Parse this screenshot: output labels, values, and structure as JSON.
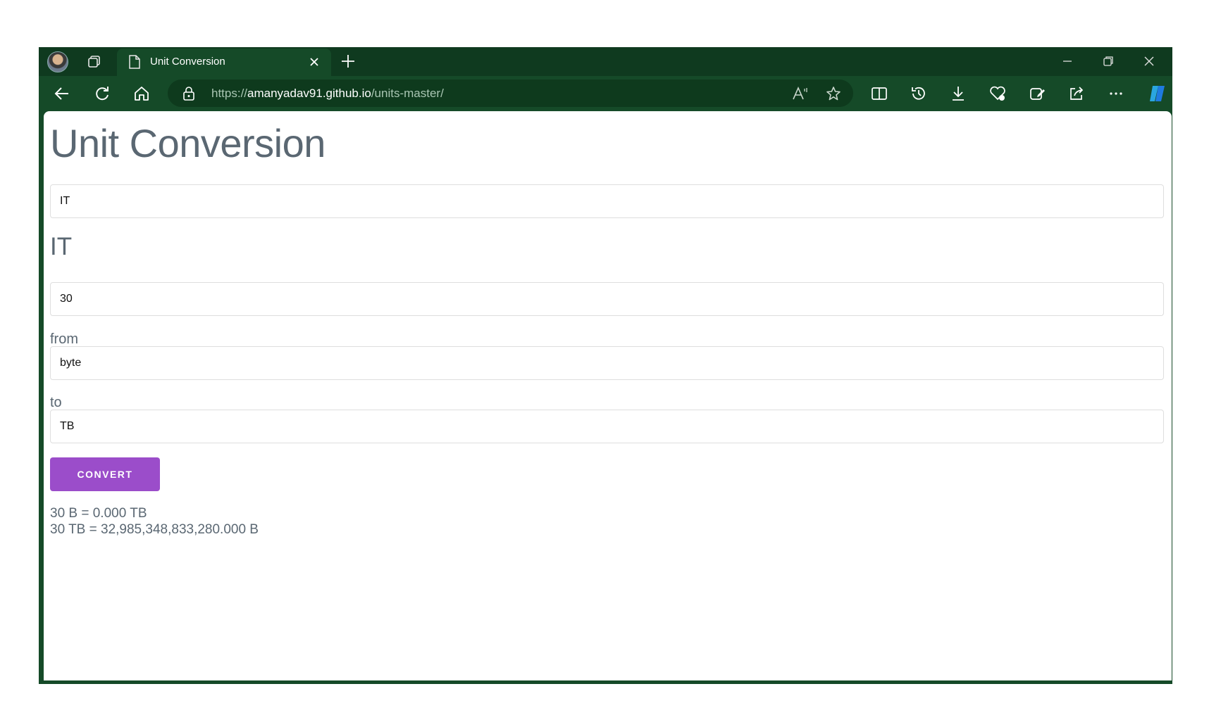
{
  "browser": {
    "tab_title": "Unit Conversion",
    "url_scheme": "https://",
    "url_host": "amanyadav91.github.io",
    "url_path": "/units-master/"
  },
  "page": {
    "title": "Unit Conversion",
    "category_select": "IT",
    "category_heading": "IT",
    "amount_value": "30",
    "from_label": "from",
    "from_value": "byte",
    "to_label": "to",
    "to_value": "TB",
    "convert_label": "CONVERT",
    "results": [
      "30 B = 0.000 TB",
      "30 TB = 32,985,348,833,280.000 B"
    ]
  },
  "colors": {
    "browser_frame": "#154a28",
    "accent_button": "#9b4dca",
    "text_muted": "#5a6772"
  }
}
